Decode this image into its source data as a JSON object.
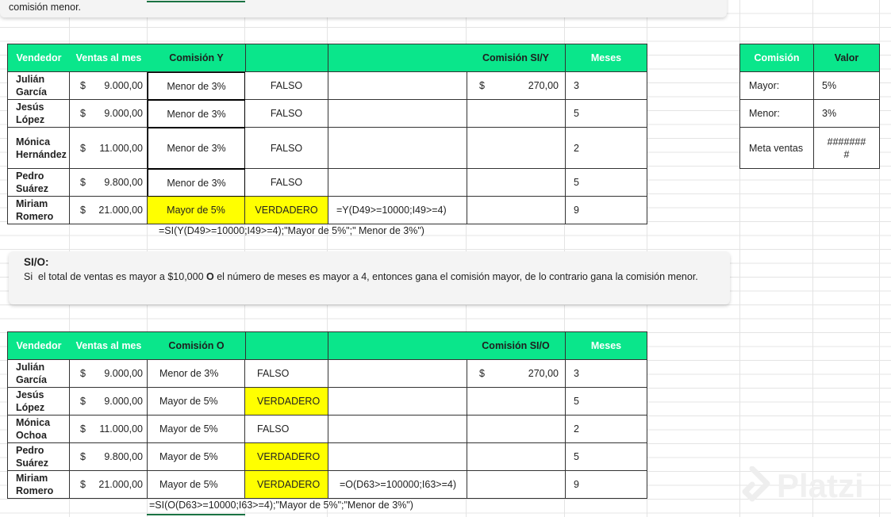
{
  "top_banner": {
    "tail_text": "comisión menor."
  },
  "table_y": {
    "headers": [
      "Vendedor",
      "Ventas al mes",
      "Comisión Y",
      "",
      "",
      "Comisión SI/Y",
      "Meses"
    ],
    "rows": [
      {
        "name": "Julián García",
        "currency": "$",
        "amount": "9.000,00",
        "commission": "Menor de 3%",
        "bool": "FALSO",
        "formula": "",
        "si_currency": "$",
        "si_value": "270,00",
        "months": "3"
      },
      {
        "name": "Jesús López",
        "currency": "$",
        "amount": "9.000,00",
        "commission": "Menor de 3%",
        "bool": "FALSO",
        "formula": "",
        "si_currency": "",
        "si_value": "",
        "months": "5"
      },
      {
        "name": "Mónica Hernández",
        "currency": "$",
        "amount": "11.000,00",
        "commission": "Menor de 3%",
        "bool": "FALSO",
        "formula": "",
        "si_currency": "",
        "si_value": "",
        "months": "2"
      },
      {
        "name": "Pedro Suárez",
        "currency": "$",
        "amount": "9.800,00",
        "commission": "Menor de 3%",
        "bool": "FALSO",
        "formula": "",
        "si_currency": "",
        "si_value": "",
        "months": "5"
      },
      {
        "name": "Miriam Romero",
        "currency": "$",
        "amount": "21.000,00",
        "commission": "Mayor de 5%",
        "bool": "VERDADERO",
        "formula": "=Y(D49>=10000;I49>=4)",
        "si_currency": "",
        "si_value": "",
        "months": "9"
      }
    ],
    "formula_below": "=SI(Y(D49>=10000;I49>=4);\"Mayor de 5%\";\" Menor de 3%\")"
  },
  "rates_table": {
    "headers": [
      "Comisión",
      "Valor"
    ],
    "rows": [
      {
        "label": "Mayor:",
        "value": "5%"
      },
      {
        "label": "Menor:",
        "value": "3%"
      },
      {
        "label": "Meta ventas",
        "value": "#######\n#"
      }
    ]
  },
  "si_o_note": {
    "title": "SI/O:",
    "text_before": "Si  el total de ventas es mayor a $10,000 ",
    "bold_word": "O",
    "text_after": " el número de meses es mayor a 4, entonces gana el comisión mayor, de lo contrario gana la comisión menor."
  },
  "table_o": {
    "headers": [
      "Vendedor",
      "Ventas al mes",
      "Comisión O",
      "",
      "",
      "Comisión SI/O",
      "Meses"
    ],
    "rows": [
      {
        "name": "Julián García",
        "currency": "$",
        "amount": "9.000,00",
        "commission": "Menor de 3%",
        "bool": "FALSO",
        "formula": "",
        "si_currency": "$",
        "si_value": "270,00",
        "months": "3"
      },
      {
        "name": "Jesús López",
        "currency": "$",
        "amount": "9.000,00",
        "commission": "Mayor de 5%",
        "bool": "VERDADERO",
        "formula": "",
        "si_currency": "",
        "si_value": "",
        "months": "5"
      },
      {
        "name": "Mónica Ochoa",
        "currency": "$",
        "amount": "11.000,00",
        "commission": "Mayor de 5%",
        "bool": "FALSO",
        "formula": "",
        "si_currency": "",
        "si_value": "",
        "months": "2"
      },
      {
        "name": "Pedro Suárez",
        "currency": "$",
        "amount": "9.800,00",
        "commission": "Mayor de 5%",
        "bool": "VERDADERO",
        "formula": "",
        "si_currency": "",
        "si_value": "",
        "months": "5"
      },
      {
        "name": "Miriam Romero",
        "currency": "$",
        "amount": "21.000,00",
        "commission": "Mayor de 5%",
        "bool": "VERDADERO",
        "formula": "=O(D63>=100000;I63>=4)",
        "si_currency": "",
        "si_value": "",
        "months": "9"
      }
    ],
    "formula_below": "=SI(O(D63>=10000;I63>=4);\"Mayor de 5%\";\"Menor de 3%\")"
  },
  "watermark": {
    "text": "Platzi"
  },
  "colors": {
    "header_green": "#0ae68b",
    "highlight_yellow": "#ffff00",
    "grid_line": "#e4e4e4"
  }
}
